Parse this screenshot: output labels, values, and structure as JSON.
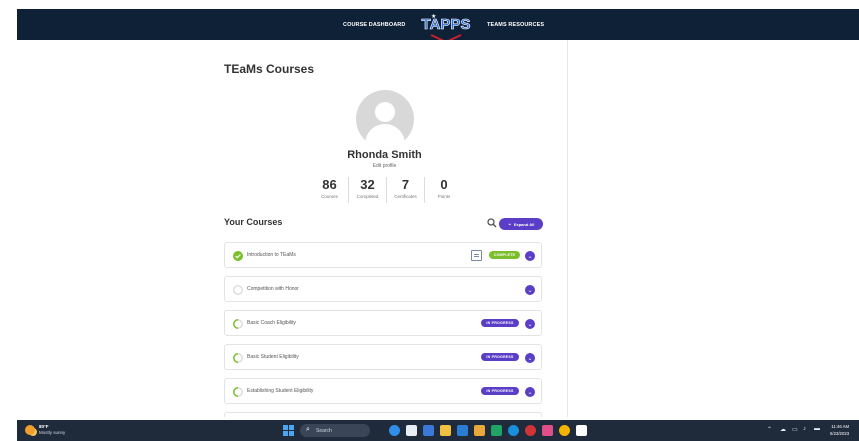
{
  "nav": {
    "dashboard_label": "COURSE DASHBOARD",
    "resources_label": "TEAMS RESOURCES",
    "logo_text": "TAPPS"
  },
  "page": {
    "title": "TEaMs Courses"
  },
  "profile": {
    "name": "Rhonda Smith",
    "edit_label": "Edit profile",
    "stats": [
      {
        "value": "86",
        "label": "Courses"
      },
      {
        "value": "32",
        "label": "Completed"
      },
      {
        "value": "7",
        "label": "Certificates"
      },
      {
        "value": "0",
        "label": "Points"
      }
    ]
  },
  "courses_section": {
    "title": "Your Courses",
    "expand_label": "Expand All",
    "items": [
      {
        "name": "Introduction to TEaMs",
        "status": "COMPLETE",
        "status_icon": "check-circle-icon",
        "has_certificate": true
      },
      {
        "name": "Competition with Honor",
        "status": "",
        "status_icon": "empty-circle-icon",
        "has_certificate": false
      },
      {
        "name": "Basic Coach Eligibility",
        "status": "IN PROGRESS",
        "status_icon": "partial-circle-icon",
        "has_certificate": false
      },
      {
        "name": "Basic Student Eligibility",
        "status": "IN PROGRESS",
        "status_icon": "partial-circle-icon",
        "has_certificate": false
      },
      {
        "name": "Establishing Student Eligibility",
        "status": "IN PROGRESS",
        "status_icon": "partial-circle-icon",
        "has_certificate": false
      }
    ]
  },
  "taskbar": {
    "weather_temp": "80°F",
    "weather_cond": "Mostly sunny",
    "search_placeholder": "Search",
    "time": "11:46 AM",
    "date": "6/23/2023"
  },
  "colors": {
    "nav_bg": "#0f2136",
    "accent_purple": "#5b3ec8",
    "complete_green": "#7bbf2a",
    "taskbar_bg": "#1f2a3a"
  }
}
